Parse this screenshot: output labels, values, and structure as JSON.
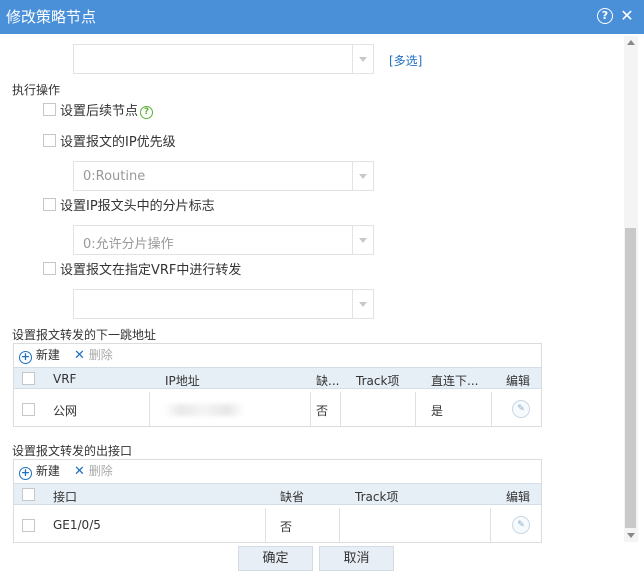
{
  "dialog": {
    "title": "修改策略节点",
    "help_icon": "?",
    "close_icon": "✕"
  },
  "form": {
    "top_select_value": "",
    "multi_link": "[多选]",
    "section_label": "执行操作",
    "options": [
      {
        "label": "设置后续节点",
        "help": "?"
      },
      {
        "label": "设置报文的IP优先级",
        "select_value": "0:Routine"
      },
      {
        "label": "设置IP报文头中的分片标志",
        "select_value": "0:允许分片操作"
      },
      {
        "label": "设置报文在指定VRF中进行转发",
        "select_value": ""
      }
    ]
  },
  "nexthop": {
    "title": "设置报文转发的下一跳地址",
    "toolbar": {
      "new": "新建",
      "delete": "删除"
    },
    "columns": [
      "VRF",
      "IP地址",
      "缺...",
      "Track项",
      "直连下...",
      "编辑"
    ],
    "rows": [
      {
        "vrf": "公网",
        "ip": "",
        "default": "否",
        "track": "",
        "direct": "是"
      }
    ]
  },
  "outif": {
    "title": "设置报文转发的出接口",
    "toolbar": {
      "new": "新建",
      "delete": "删除"
    },
    "columns": [
      "接口",
      "缺省",
      "Track项",
      "编辑"
    ],
    "rows": [
      {
        "interface": "GE1/0/5",
        "default": "否",
        "track": ""
      }
    ]
  },
  "buttons": {
    "ok": "确定",
    "cancel": "取消"
  }
}
